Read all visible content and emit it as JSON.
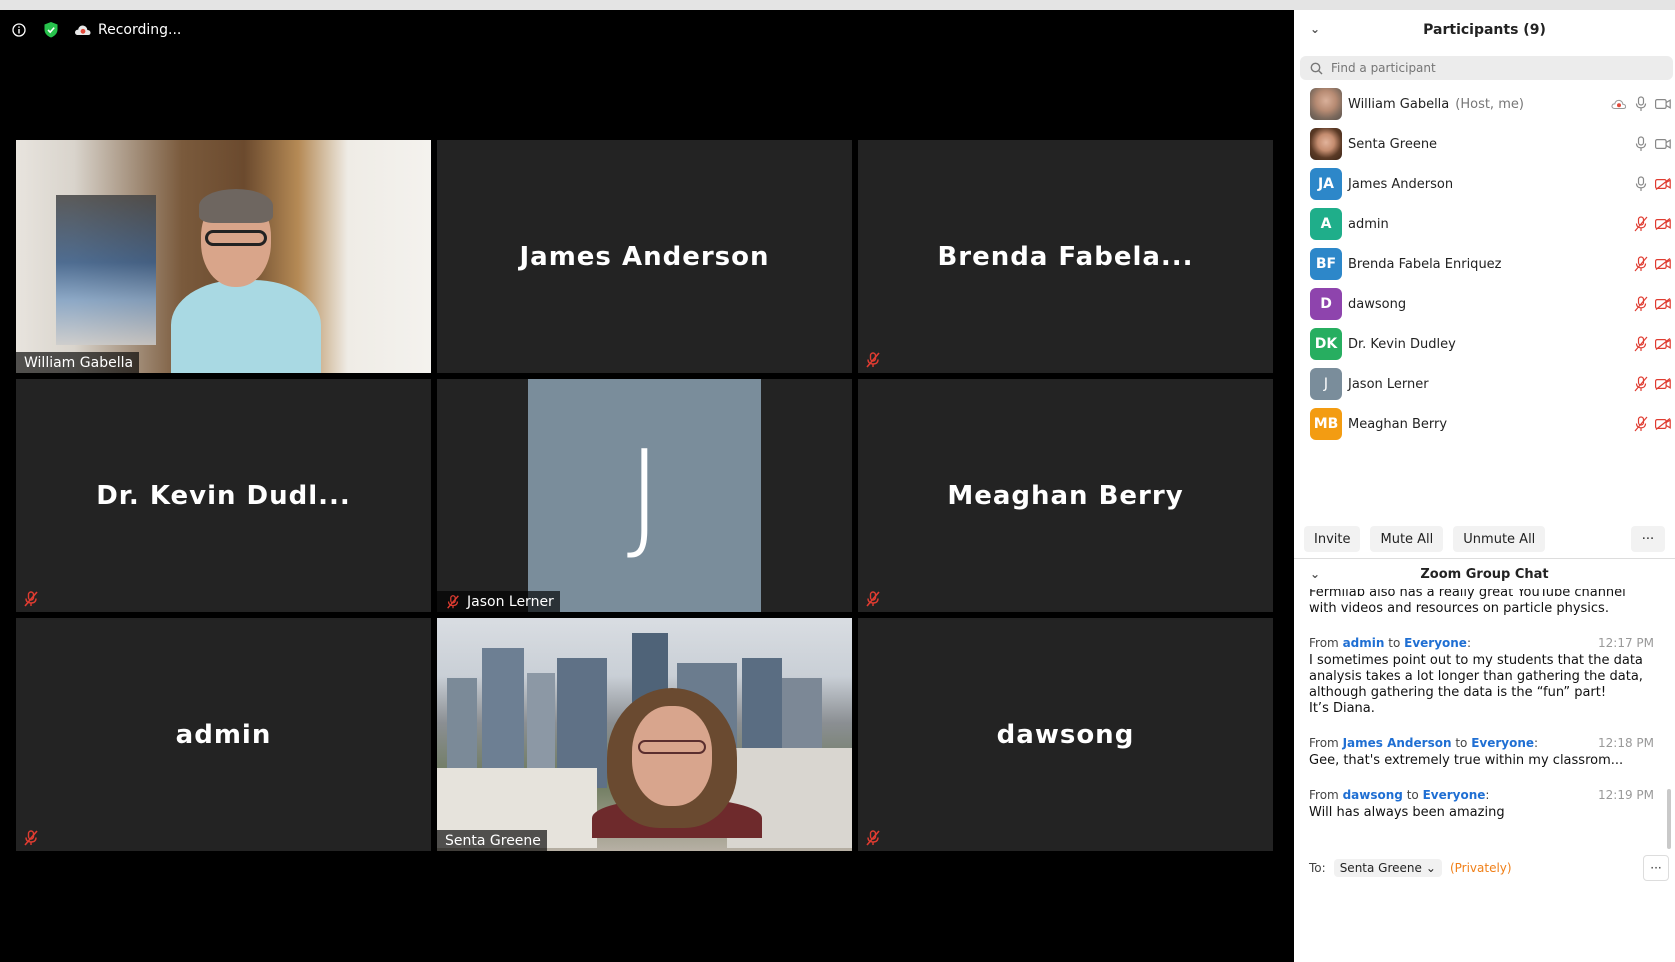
{
  "status": {
    "recording_label": "Recording..."
  },
  "tiles": [
    {
      "name": "William Gabella",
      "display": "William Gabella",
      "muted": false,
      "video": true
    },
    {
      "name": "James Anderson",
      "display": "James Anderson",
      "muted": false,
      "video": false
    },
    {
      "name": "Brenda Fabela Enriquez",
      "display": "Brenda Fabela...",
      "muted": true,
      "video": false
    },
    {
      "name": "Dr. Kevin Dudley",
      "display": "Dr. Kevin Dudl...",
      "muted": true,
      "video": false
    },
    {
      "name": "Jason Lerner",
      "display": "Jason Lerner",
      "initial": "J",
      "muted": true,
      "video": false
    },
    {
      "name": "Meaghan Berry",
      "display": "Meaghan Berry",
      "muted": true,
      "video": false
    },
    {
      "name": "admin",
      "display": "admin",
      "muted": true,
      "video": false
    },
    {
      "name": "Senta Greene",
      "display": "Senta Greene",
      "muted": false,
      "video": true,
      "active_speaker": true
    },
    {
      "name": "dawsong",
      "display": "dawsong",
      "muted": true,
      "video": false
    }
  ],
  "participants_panel": {
    "title": "Participants (9)",
    "search_placeholder": "Find a participant",
    "participants": [
      {
        "name": "William Gabella",
        "role": "(Host, me)",
        "avatar": "photo",
        "avatar_color": "",
        "mic": "on",
        "video": "on",
        "recording": true
      },
      {
        "name": "Senta Greene",
        "role": "",
        "avatar": "photo",
        "avatar_color": "",
        "mic": "on",
        "video": "on"
      },
      {
        "name": "James Anderson",
        "role": "",
        "avatar": "JA",
        "avatar_color": "#2d87c9",
        "mic": "on",
        "video": "off"
      },
      {
        "name": "admin",
        "role": "",
        "avatar": "A",
        "avatar_color": "#1fae8a",
        "mic": "off",
        "video": "off"
      },
      {
        "name": "Brenda Fabela Enriquez",
        "role": "",
        "avatar": "BF",
        "avatar_color": "#2d87c9",
        "mic": "off",
        "video": "off"
      },
      {
        "name": "dawsong",
        "role": "",
        "avatar": "D",
        "avatar_color": "#8e44ad",
        "mic": "off",
        "video": "off"
      },
      {
        "name": "Dr. Kevin Dudley",
        "role": "",
        "avatar": "DK",
        "avatar_color": "#27ae60",
        "mic": "off",
        "video": "off"
      },
      {
        "name": "Jason Lerner",
        "role": "",
        "avatar": "J",
        "avatar_color": "#7a8d9b",
        "mic": "off",
        "video": "off"
      },
      {
        "name": "Meaghan Berry",
        "role": "",
        "avatar": "MB",
        "avatar_color": "#f39c12",
        "mic": "off",
        "video": "off"
      }
    ],
    "buttons": {
      "invite": "Invite",
      "mute_all": "Mute All",
      "unmute_all": "Unmute All",
      "more": "···"
    }
  },
  "chat": {
    "title": "Zoom Group Chat",
    "partial_message": "Fermilab also has a really great YouTube channel\nwith videos and resources on particle physics.",
    "messages": [
      {
        "from": "admin",
        "to": "Everyone",
        "time": "12:17 PM",
        "text": "I sometimes point out to my students that the data analysis takes a lot longer than gathering the data, although gathering the data is the “fun” part!\nIt’s Diana."
      },
      {
        "from": "James Anderson",
        "to": "Everyone",
        "time": "12:18 PM",
        "text": "Gee, that's extremely true within my classrom..."
      },
      {
        "from": "dawsong",
        "to": "Everyone",
        "time": "12:19 PM",
        "text": "Will has always been amazing"
      }
    ],
    "from_word": "From",
    "to_word": "to",
    "to_label": "To:",
    "recipient": "Senta Greene",
    "privacy": "(Privately)",
    "more": "···"
  },
  "colors": {
    "accent": "#1f6fd3",
    "muted_red": "#e03c31",
    "active_speaker_border": "#d4e68a",
    "private_orange": "#f07f17"
  }
}
